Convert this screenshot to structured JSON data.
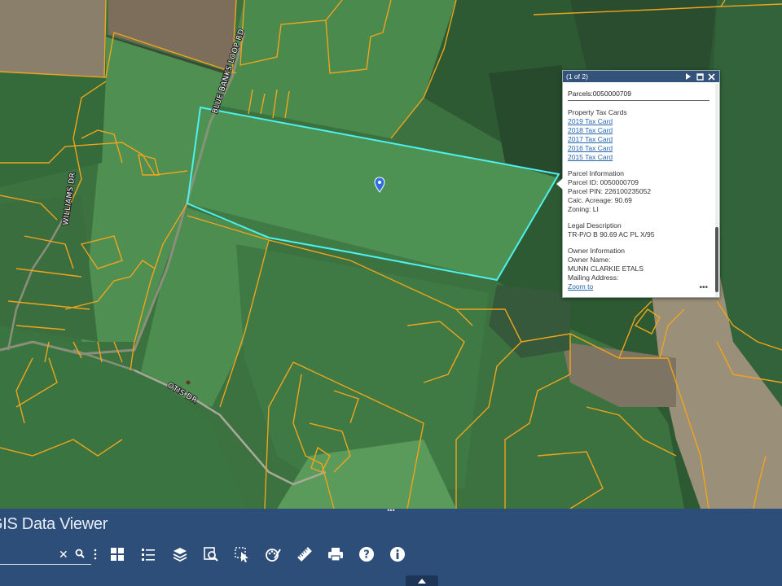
{
  "map": {
    "road_labels": {
      "blue_banks": "BLUE BANKS LOOP RD",
      "williams": "WILLIAMS DR",
      "otis": "OTIS DR"
    },
    "colors": {
      "parcel_line": "#f0a41c",
      "selected_outline": "#4df2ee",
      "field": "#4a8a4e",
      "forest": "#2c5a33"
    }
  },
  "popup": {
    "counter": "(1 of 2)",
    "title": "Parcels:0050000709",
    "tax_cards": {
      "heading": "Property Tax Cards",
      "links": [
        "2019 Tax Card",
        "2018 Tax Card",
        "2017 Tax Card",
        "2016 Tax Card",
        "2015 Tax Card"
      ]
    },
    "parcel_info": {
      "heading": "Parcel Information",
      "lines": [
        "Parcel ID: 0050000709",
        "Parcel PIN: 226100235052",
        "Calc. Acreage: 90.69",
        "Zoning: LI"
      ]
    },
    "legal": {
      "heading": "Legal Description",
      "lines": [
        "TR-P/O B 90.69 AC PL X/95"
      ]
    },
    "owner": {
      "heading": "Owner Information",
      "lines": [
        "Owner Name:",
        "MUNN CLARKIE ETALS",
        "Mailing Address:"
      ]
    },
    "zoom_link": "Zoom to",
    "more": "•••",
    "icons": [
      "play-icon",
      "maximize-icon",
      "close-icon"
    ]
  },
  "panel": {
    "title": "GIS Data Viewer",
    "handle": "•••",
    "search": {
      "value": "",
      "placeholder": ""
    },
    "tools": [
      "basemap-gallery-icon",
      "legend-icon",
      "layer-list-icon",
      "query-icon",
      "select-icon",
      "draw-icon",
      "measure-icon",
      "print-icon",
      "help-icon",
      "about-icon"
    ]
  }
}
